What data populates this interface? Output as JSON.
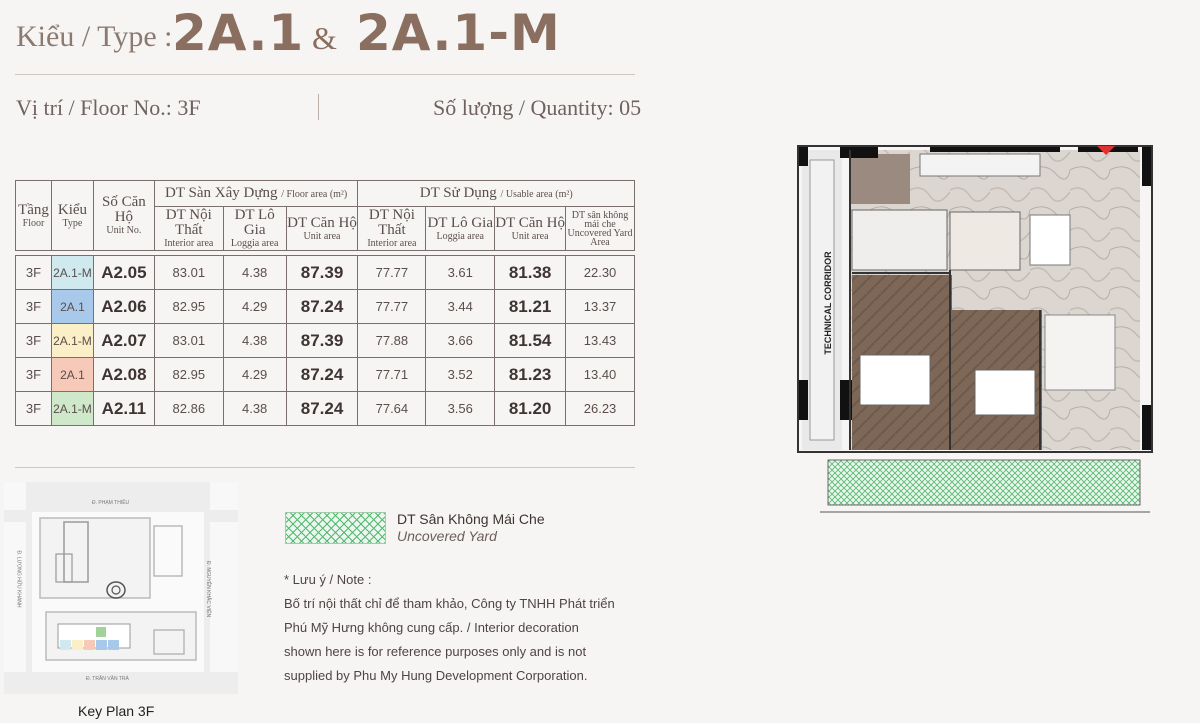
{
  "header": {
    "type_label": "Kiểu / Type :",
    "type_a": "2A.1",
    "amp": "&",
    "type_b": "2A.1-M",
    "floor": "Vị trí / Floor No.: 3F",
    "quantity": "Số lượng / Quantity:  05"
  },
  "table": {
    "h_floor": "Tầng",
    "h_floor_en": "Floor",
    "h_type": "Kiểu",
    "h_type_en": "Type",
    "h_unit": "Số Căn Hộ",
    "h_unit_en": "Unit No.",
    "g_floor_area": "DT Sàn Xây Dựng",
    "g_floor_area_en": "/ Floor area (m²)",
    "g_usable": "DT Sử Dụng",
    "g_usable_en": "/ Usable area (m²)",
    "c_interior": "DT Nội Thất",
    "c_interior_en": "Interior area",
    "c_loggia": "DT Lô Gia",
    "c_loggia_en": "Loggia area",
    "c_unit": "DT Căn Hộ",
    "c_unit_en": "Unit area",
    "c_yard": "DT sân không mái che",
    "c_yard_en": "Uncovered Yard Area",
    "rows": [
      {
        "floor": "3F",
        "type": "2A.1-M",
        "type_color": "#cfe9ef",
        "unit": "A2.05",
        "f_int": "83.01",
        "f_log": "4.38",
        "f_unit": "87.39",
        "u_int": "77.77",
        "u_log": "3.61",
        "u_unit": "81.38",
        "yard": "22.30"
      },
      {
        "floor": "3F",
        "type": "2A.1",
        "type_color": "#a9c9ea",
        "unit": "A2.06",
        "f_int": "82.95",
        "f_log": "4.29",
        "f_unit": "87.24",
        "u_int": "77.77",
        "u_log": "3.44",
        "u_unit": "81.21",
        "yard": "13.37"
      },
      {
        "floor": "3F",
        "type": "2A.1-M",
        "type_color": "#fbefc7",
        "unit": "A2.07",
        "f_int": "83.01",
        "f_log": "4.38",
        "f_unit": "87.39",
        "u_int": "77.88",
        "u_log": "3.66",
        "u_unit": "81.54",
        "yard": "13.43"
      },
      {
        "floor": "3F",
        "type": "2A.1",
        "type_color": "#f7c9b8",
        "unit": "A2.08",
        "f_int": "82.95",
        "f_log": "4.29",
        "f_unit": "87.24",
        "u_int": "77.71",
        "u_log": "3.52",
        "u_unit": "81.23",
        "yard": "13.40"
      },
      {
        "floor": "3F",
        "type": "2A.1-M",
        "type_color": "#cfe8c9",
        "unit": "A2.11",
        "f_int": "82.86",
        "f_log": "4.38",
        "f_unit": "87.24",
        "u_int": "77.64",
        "u_log": "3.56",
        "u_unit": "81.20",
        "yard": "26.23"
      }
    ]
  },
  "keyplan": {
    "caption": "Key Plan 3F",
    "street_top": "Đ. PHẠM THIỀU",
    "street_left": "Đ. LƯƠNG HỮU KHÁNH",
    "street_right": "Đ. NGUYỄN KHẮC VIỆN",
    "street_bottom": "Đ. TRẦN VĂN TRÀ"
  },
  "legend": {
    "label_vi": "DT Sân Không Mái Che",
    "label_en": "Uncovered Yard",
    "swatch_color": "#55b86f"
  },
  "note": {
    "title": "* Lưu ý / Note :",
    "lines": [
      "Bố trí nội thất chỉ để tham khảo, Công ty TNHH Phát triển",
      "Phú Mỹ Hưng không cung cấp. / Interior decoration",
      "shown here is for reference purposes only and is not",
      "supplied by Phu My Hung Development Corporation."
    ]
  },
  "plan": {
    "corridor_label": "TECHNICAL CORRIDOR",
    "marble_color": "#d9d2cc",
    "wood_color": "#7b6556",
    "marker_color": "#e03030"
  }
}
